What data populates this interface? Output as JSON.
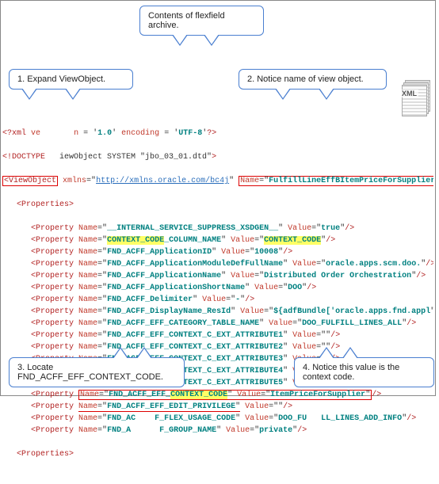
{
  "callouts": {
    "top": "Contents of flexfield archive.",
    "c1": "1. Expand ViewObject.",
    "c2": "2. Notice name of view object.",
    "c3": "3. Locate FND_ACFF_EFF_CONTEXT_CODE.",
    "c4": "4. Notice this value is the context code."
  },
  "xmlIconLabel": "XML",
  "code": {
    "decl": "<?xml ve",
    "declMid": "n = '1.0' encoding = 'UTF-8'?>",
    "doctype": "<!DOCTYPE",
    "doctypeRest": "iewObject SYSTEM \"jbo_03_01.dtd\">",
    "viewObjTag": "ViewObject",
    "xmlnsAttr": "xmlns",
    "xmlnsUrl": "http://xmlns.oracle.com/bc4j",
    "nameAttr": "Name",
    "viewObjName": "FulfillLineEffBItemPriceForSuppliers",
    "propertiesTag": "Properties",
    "propTag": "Property",
    "props": [
      {
        "name": "__INTERNAL_SERVICE_SUPPRESS_XSDGEN__",
        "value": "true"
      },
      {
        "name": "CONTEXT_CODE_COLUMN_NAME",
        "value": "CONTEXT_CODE",
        "hlName": true,
        "hlVal": true
      },
      {
        "name": "FND_ACFF_ApplicationID",
        "value": "10008"
      },
      {
        "name": "FND_ACFF_ApplicationModuleDefFullName",
        "value": "oracle.apps.scm.doo."
      },
      {
        "name": "FND_ACFF_ApplicationName",
        "value": "Distributed Order Orchestration"
      },
      {
        "name": "FND_ACFF_ApplicationShortName",
        "value": "DOO"
      },
      {
        "name": "FND_ACFF_Delimiter",
        "value": "-"
      },
      {
        "name": "FND_ACFF_DisplayName_ResId",
        "value": "${adfBundle['oracle.apps.fnd.appl"
      },
      {
        "name": "FND_ACFF_EFF_CATEGORY_TABLE_NAME",
        "value": "DOO_FULFILL_LINES_ALL"
      },
      {
        "name": "FND_ACFF_EFF_CONTEXT_C_EXT_ATTRIBUTE1",
        "value": ""
      },
      {
        "name": "FND_ACFF_EFF_CONTEXT_C_EXT_ATTRIBUTE2",
        "value": ""
      },
      {
        "name": "FND_ACFF_EFF_CONTEXT_C_EXT_ATTRIBUTE3",
        "value": ""
      },
      {
        "name": "FND_ACFF_EFF_CONTEXT_C_EXT_ATTRIBUTE4",
        "value": ""
      },
      {
        "name": "FND_ACFF_EFF_CONTEXT_C_EXT_ATTRIBUTE5",
        "value": ""
      },
      {
        "name": "FND_ACFF_EFF_CONTEXT_CODE",
        "value": "ItemPriceForSupplier",
        "hlContext": true,
        "redBox": true
      },
      {
        "name": "FND_ACFF_EFF_EDIT_PRIVILEGE",
        "value": "",
        "underName": true
      },
      {
        "name": "FND_ACFF_EFF_FLEX_USAGE_CODE",
        "value": "DOO_FULFILL_LINES_ADD_INFO",
        "partial": true
      },
      {
        "name": "FND_ACFF_EFF_GROUP_NAME",
        "value": "private",
        "partial": true
      }
    ]
  }
}
